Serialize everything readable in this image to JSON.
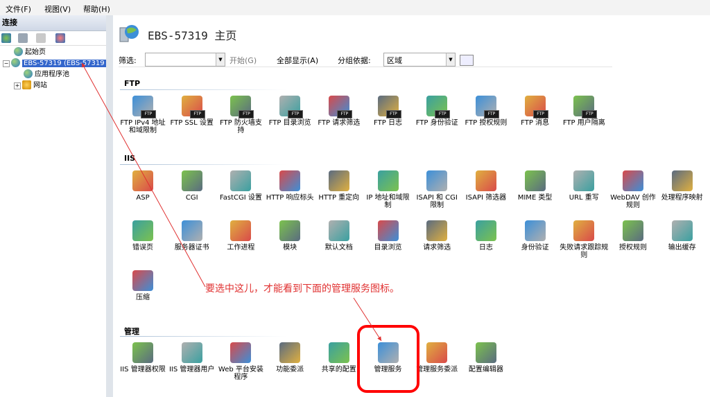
{
  "menu": [
    "文件(F)",
    "视图(V)",
    "帮助(H)"
  ],
  "connections": {
    "header": "连接",
    "tree": [
      "起始页",
      "EBS-57319 (EBS-57319",
      "应用程序池",
      "网站"
    ]
  },
  "main": {
    "title": "EBS-57319 主页",
    "filter": {
      "label": "筛选:",
      "start": "开始(G)",
      "show_all": "全部显示(A)",
      "group_by_label": "分组依据:",
      "group_by_value": "区域"
    },
    "sections": [
      {
        "name": "FTP",
        "tiles": [
          "FTP IPv4 地址和域限制",
          "FTP SSL 设置",
          "FTP 防火墙支持",
          "FTP 目录浏览",
          "FTP 请求筛选",
          "FTP 日志",
          "FTP 身份验证",
          "FTP 授权规则",
          "FTP 消息",
          "FTP 用户隔离"
        ]
      },
      {
        "name": "IIS",
        "tiles": [
          "ASP",
          "CGI",
          "FastCGI 设置",
          "HTTP 响应标头",
          "HTTP 重定向",
          "IP 地址和域限制",
          "ISAPI 和 CGI 限制",
          "ISAPI 筛选器",
          "MIME 类型",
          "URL 重写",
          "WebDAV 创作规则",
          "处理程序映射",
          "错误页",
          "服务器证书",
          "工作进程",
          "模块",
          "默认文档",
          "目录浏览",
          "请求筛选",
          "日志",
          "身份验证",
          "失败请求跟踪规则",
          "授权规则",
          "输出缓存",
          "压缩"
        ]
      },
      {
        "name": "管理",
        "tiles": [
          "IIS 管理器权限",
          "IIS 管理器用户",
          "Web 平台安装程序",
          "功能委派",
          "共享的配置",
          "管理服务",
          "管理服务委派",
          "配置编辑器"
        ]
      }
    ]
  },
  "annotation": "要选中这儿，才能看到下面的管理服务图标。",
  "colors": {
    "accent_red": "#ff0000",
    "selection": "#3366cc"
  }
}
